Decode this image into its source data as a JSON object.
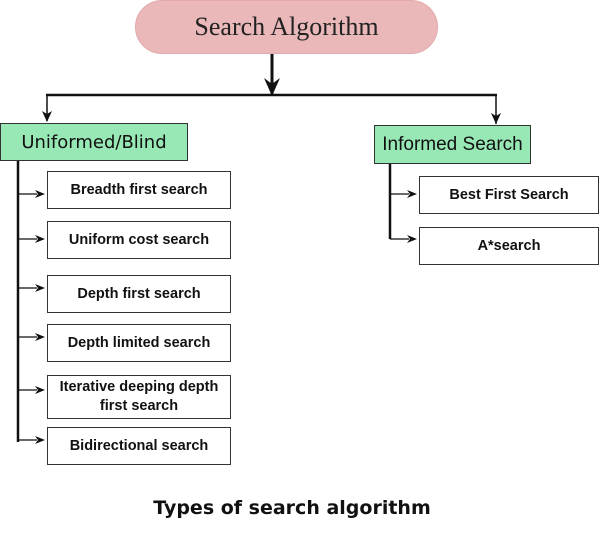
{
  "root": {
    "label": "Search Algorithm",
    "color": "#ebb8ba"
  },
  "categories": [
    {
      "label": "Uniformed/Blind",
      "color": "#98e8b6",
      "children": [
        "Breadth first search",
        "Uniform cost search",
        "Depth first search",
        "Depth limited search",
        "Iterative deeping depth first search",
        "Bidirectional search"
      ]
    },
    {
      "label": "Informed Search",
      "color": "#98e8b6",
      "children": [
        "Best First Search",
        "A*search"
      ]
    }
  ],
  "caption": "Types of search algorithm"
}
